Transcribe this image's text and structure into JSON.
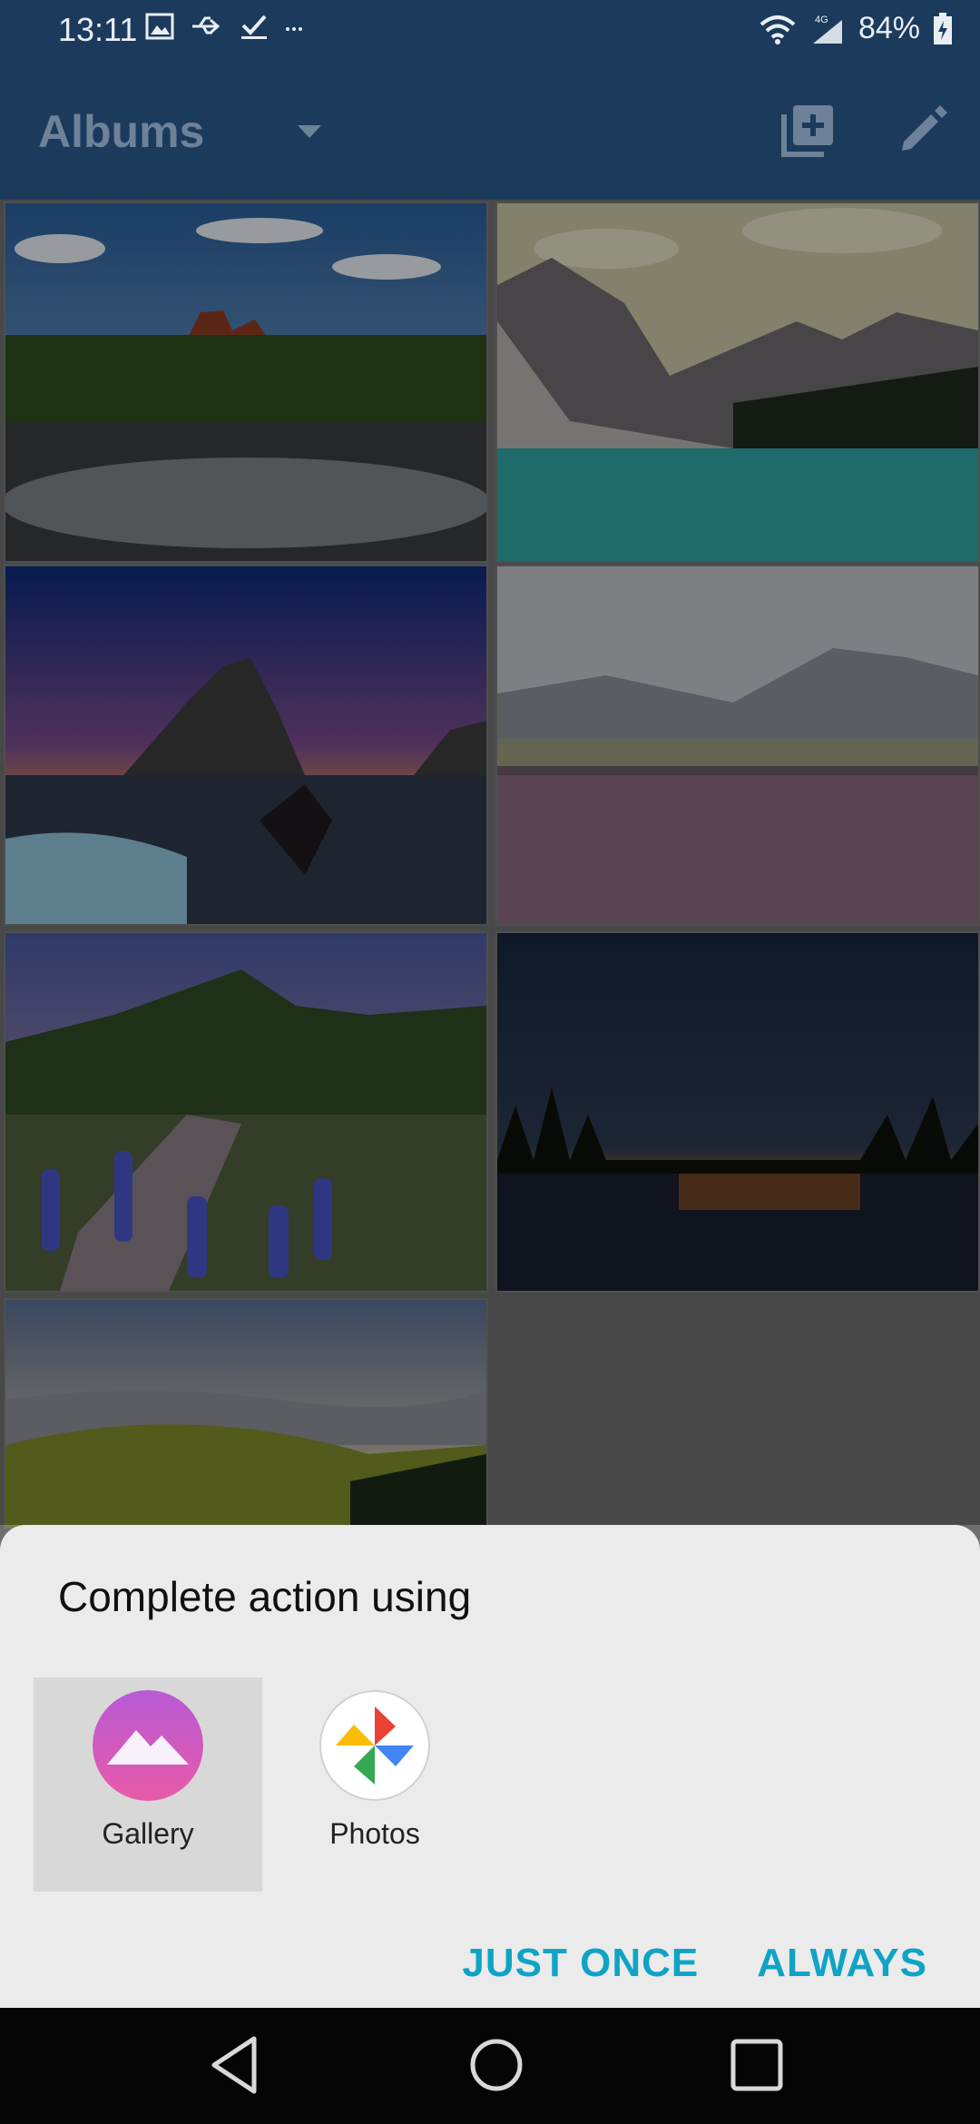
{
  "status_bar": {
    "time": "13:11",
    "battery": "84%",
    "network": "4G"
  },
  "app_bar": {
    "title": "Albums"
  },
  "album_grid": {
    "tiles": [
      {
        "icon": "landscape-river"
      },
      {
        "icon": "mountain-lake"
      },
      {
        "icon": "rock-sunset"
      },
      {
        "icon": "flower-field"
      },
      {
        "icon": "lupine-mountain"
      },
      {
        "icon": "night-lake"
      },
      {
        "icon": "misty-hills"
      }
    ]
  },
  "dialog": {
    "title": "Complete action using",
    "apps": [
      {
        "label": "Gallery",
        "icon": "gallery-icon"
      },
      {
        "label": "Photos",
        "icon": "photos-icon"
      }
    ],
    "buttons": {
      "just_once": "JUST ONCE",
      "always": "ALWAYS"
    }
  },
  "colors": {
    "app_bar": "#1b3a5c",
    "accent": "#0fa3c6",
    "sheet": "#ebebeb"
  }
}
